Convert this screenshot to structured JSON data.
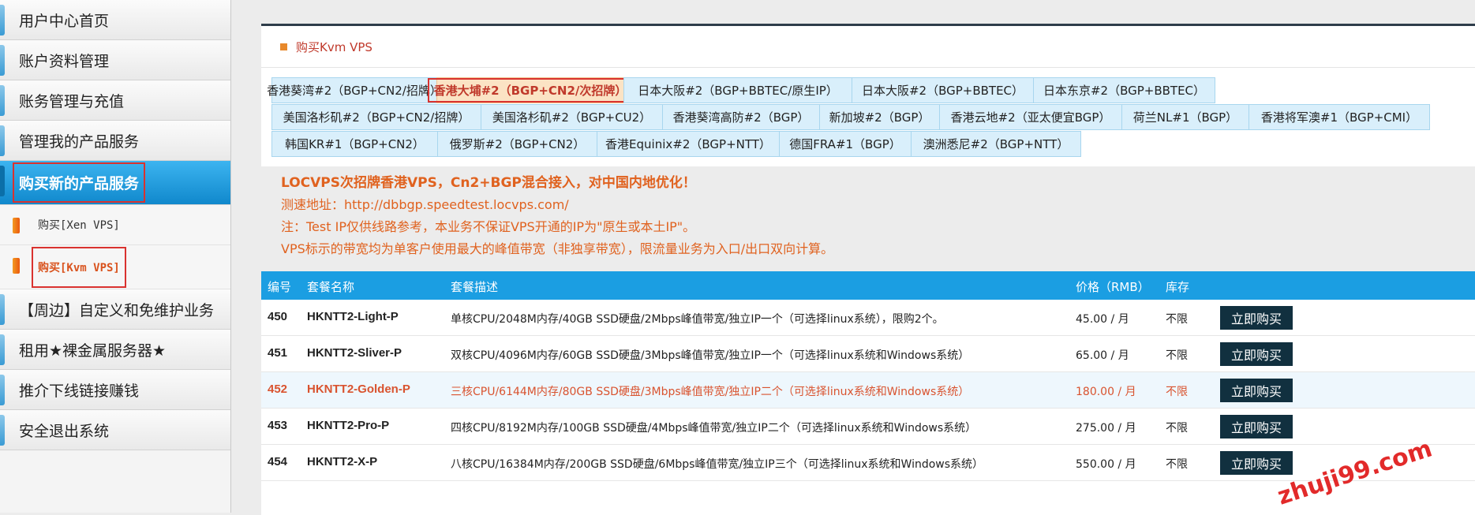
{
  "sidebar": {
    "items": [
      {
        "label": "用户中心首页"
      },
      {
        "label": "账户资料管理"
      },
      {
        "label": "账务管理与充值"
      },
      {
        "label": "管理我的产品服务"
      },
      {
        "label": "购买新的产品服务"
      },
      {
        "label": "【周边】自定义和免维护业务"
      },
      {
        "label": "租用★裸金属服务器★"
      },
      {
        "label": "推介下线链接赚钱"
      },
      {
        "label": "安全退出系统"
      }
    ],
    "sub_items": [
      {
        "label": "购买[Xen VPS]"
      },
      {
        "label": "购买[Kvm VPS]"
      }
    ]
  },
  "panel": {
    "title": "购买Kvm VPS"
  },
  "tabs": {
    "row1": [
      "香港葵湾#2（BGP+CN2/招牌）",
      "香港大埔#2（BGP+CN2/次招牌）",
      "日本大阪#2（BGP+BBTEC/原生IP）",
      "日本大阪#2（BGP+BBTEC）",
      "日本东京#2（BGP+BBTEC）"
    ],
    "row2": [
      "美国洛杉矶#2（BGP+CN2/招牌）",
      "美国洛杉矶#2（BGP+CU2）",
      "香港葵湾高防#2（BGP）",
      "新加坡#2（BGP）",
      "香港云地#2（亚太便宜BGP）",
      "荷兰NL#1（BGP）",
      "香港将军澳#1（BGP+CMI）"
    ],
    "row3": [
      "韩国KR#1（BGP+CN2）",
      "俄罗斯#2（BGP+CN2）",
      "香港Equinix#2（BGP+NTT）",
      "德国FRA#1（BGP）",
      "澳洲悉尼#2（BGP+NTT）"
    ],
    "active": "香港大埔#2（BGP+CN2/次招牌）"
  },
  "notice": {
    "line1": "LOCVPS次招牌香港VPS，Cn2+BGP混合接入，对中国内地优化！",
    "line2": "测速地址：http://dbbgp.speedtest.locvps.com/",
    "line3": "注：Test IP仅供线路参考，本业务不保证VPS开通的IP为\"原生或本土IP\"。",
    "line4": "VPS标示的带宽均为单客户使用最大的峰值带宽（非独享带宽），限流量业务为入口/出口双向计算。"
  },
  "table": {
    "headers": {
      "id": "编号",
      "name": "套餐名称",
      "desc": "套餐描述",
      "price": "价格（RMB）",
      "stock": "库存"
    },
    "buy_label": "立即购买",
    "rows": [
      {
        "id": "450",
        "name": "HKNTT2-Light-P",
        "desc": "单核CPU/2048M内存/40GB SSD硬盘/2Mbps峰值带宽/独立IP一个（可选择linux系统），限购2个。",
        "price": "45.00 / 月",
        "stock": "不限"
      },
      {
        "id": "451",
        "name": "HKNTT2-Sliver-P",
        "desc": "双核CPU/4096M内存/60GB SSD硬盘/3Mbps峰值带宽/独立IP一个（可选择linux系统和Windows系统）",
        "price": "65.00 / 月",
        "stock": "不限"
      },
      {
        "id": "452",
        "name": "HKNTT2-Golden-P",
        "desc": "三核CPU/6144M内存/80GB SSD硬盘/3Mbps峰值带宽/独立IP二个（可选择linux系统和Windows系统）",
        "price": "180.00 / 月",
        "stock": "不限"
      },
      {
        "id": "453",
        "name": "HKNTT2-Pro-P",
        "desc": "四核CPU/8192M内存/100GB SSD硬盘/4Mbps峰值带宽/独立IP二个（可选择linux系统和Windows系统）",
        "price": "275.00 / 月",
        "stock": "不限"
      },
      {
        "id": "454",
        "name": "HKNTT2-X-P",
        "desc": "八核CPU/16384M内存/200GB SSD硬盘/6Mbps峰值带宽/独立IP三个（可选择linux系统和Windows系统）",
        "price": "550.00 / 月",
        "stock": "不限"
      }
    ]
  },
  "watermark": "zhuji99.com",
  "colors": {
    "accent": "#1b9ee2",
    "active_nav": "#1088cc",
    "highlight_text": "#e0621f",
    "buy_button": "#11303f"
  }
}
